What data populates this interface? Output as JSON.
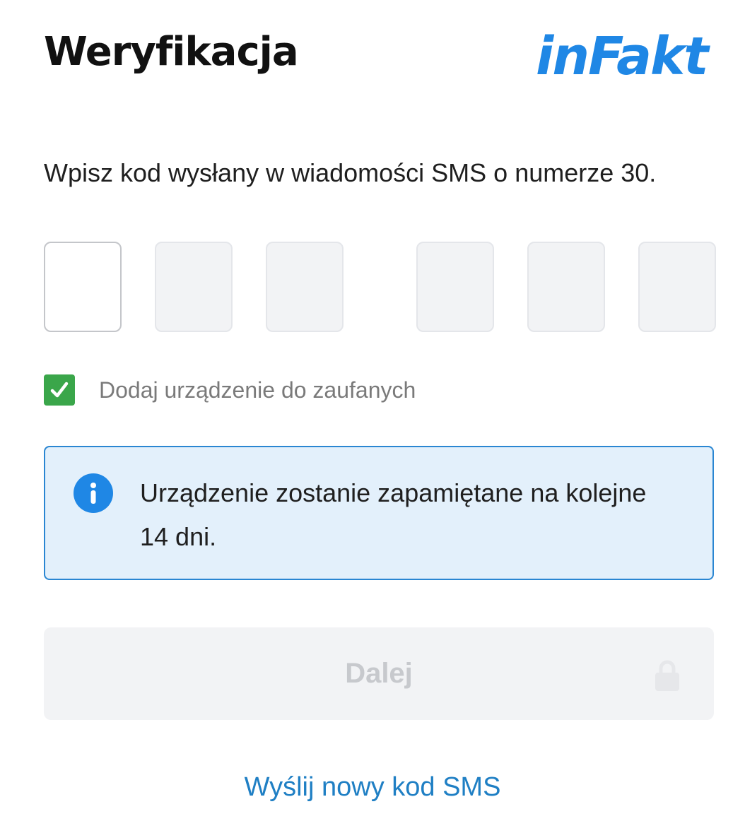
{
  "header": {
    "title": "Weryfikacja",
    "logo_text": "inFakt"
  },
  "instruction": "Wpisz kod wysłany w wiadomości SMS o numerze 30.",
  "code_inputs": {
    "count": 6,
    "values": [
      "",
      "",
      "",
      "",
      "",
      ""
    ]
  },
  "trusted_device": {
    "checked": true,
    "label": "Dodaj urządzenie do zaufanych"
  },
  "info_box": {
    "icon": "info-icon",
    "text": "Urządzenie zostanie zapamiętane na kolejne 14 dni."
  },
  "next_button": {
    "label": "Dalej",
    "disabled": true,
    "icon": "lock-icon"
  },
  "resend_link": "Wyślij nowy kod SMS",
  "colors": {
    "brand_blue": "#1f87e5",
    "checkbox_green": "#3aa64a",
    "info_background": "#e3f0fb",
    "info_border": "#2a86d2",
    "link_blue": "#1f7fc4",
    "disabled_text": "#c7c9cd"
  }
}
